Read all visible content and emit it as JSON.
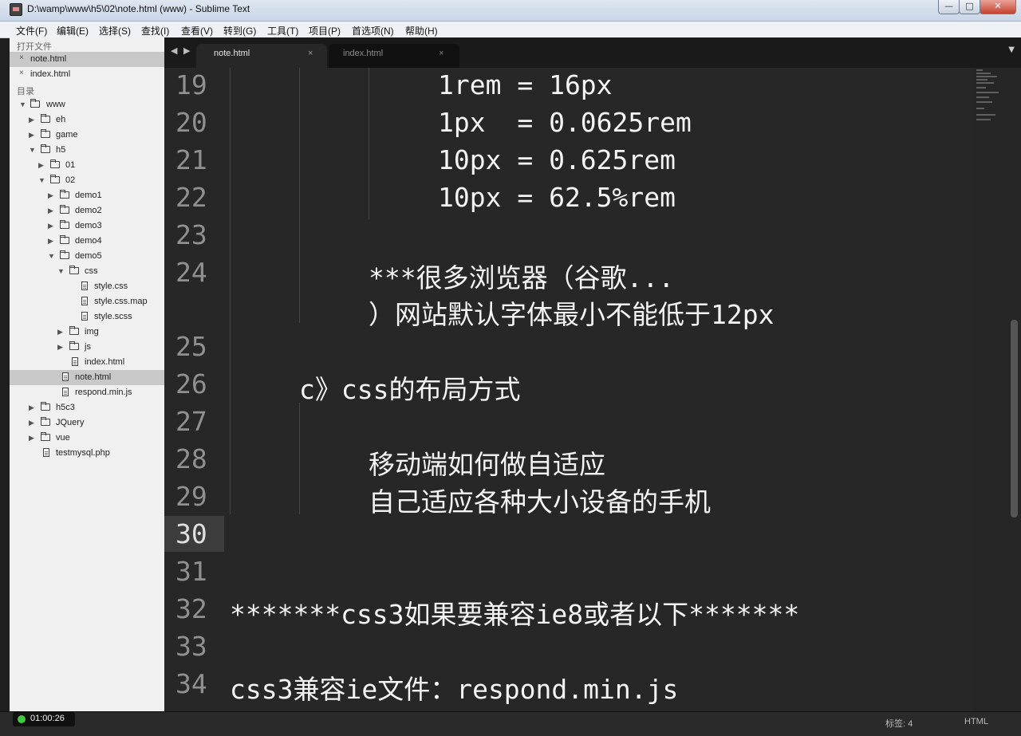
{
  "window": {
    "title": "D:\\wamp\\www\\h5\\02\\note.html (www) - Sublime Text",
    "minimize": "—",
    "maximize": "□",
    "close": "✕"
  },
  "menu": [
    "文件(F)",
    "编辑(E)",
    "选择(S)",
    "查找(I)",
    "查看(V)",
    "转到(G)",
    "工具(T)",
    "项目(P)",
    "首选项(N)",
    "帮助(H)"
  ],
  "sidebar": {
    "open_files_header": "打开文件",
    "open_files": [
      {
        "name": "note.html",
        "close": "×"
      },
      {
        "name": "index.html",
        "close": "×"
      }
    ],
    "folders_header": "目录",
    "tree": [
      {
        "name": "www",
        "type": "folder",
        "expanded": true
      },
      {
        "name": "eh",
        "type": "folder"
      },
      {
        "name": "game",
        "type": "folder"
      },
      {
        "name": "h5",
        "type": "folder",
        "expanded": true
      },
      {
        "name": "01",
        "type": "folder"
      },
      {
        "name": "02",
        "type": "folder",
        "expanded": true
      },
      {
        "name": "demo1",
        "type": "folder"
      },
      {
        "name": "demo2",
        "type": "folder"
      },
      {
        "name": "demo3",
        "type": "folder"
      },
      {
        "name": "demo4",
        "type": "folder"
      },
      {
        "name": "demo5",
        "type": "folder",
        "expanded": true
      },
      {
        "name": "css",
        "type": "folder",
        "expanded": true
      },
      {
        "name": "style.css",
        "type": "file"
      },
      {
        "name": "style.css.map",
        "type": "file"
      },
      {
        "name": "style.scss",
        "type": "file"
      },
      {
        "name": "img",
        "type": "folder"
      },
      {
        "name": "js",
        "type": "folder"
      },
      {
        "name": "index.html",
        "type": "file"
      },
      {
        "name": "note.html",
        "type": "file",
        "selected": true
      },
      {
        "name": "respond.min.js",
        "type": "file"
      },
      {
        "name": "h5c3",
        "type": "folder"
      },
      {
        "name": "JQuery",
        "type": "folder"
      },
      {
        "name": "vue",
        "type": "folder"
      },
      {
        "name": "testmysql.php",
        "type": "file"
      }
    ]
  },
  "tabs": {
    "nav": "◀ ▶",
    "active": {
      "label": "note.html",
      "close": "×"
    },
    "inactive": {
      "label": "index.html",
      "close": "×"
    },
    "dropdown": "▼"
  },
  "editor": {
    "current_line": "30",
    "lines": [
      {
        "no": "19",
        "text": "1rem = 16px"
      },
      {
        "no": "20",
        "text": "1px  = 0.0625rem"
      },
      {
        "no": "21",
        "text": "10px = 0.625rem"
      },
      {
        "no": "22",
        "text": "10px = 62.5%rem"
      },
      {
        "no": "23",
        "text": ""
      },
      {
        "no": "24",
        "text": "***很多浏览器（谷歌..."
      },
      {
        "no": "",
        "text": "）网站默认字体最小不能低于12px"
      },
      {
        "no": "25",
        "text": ""
      },
      {
        "no": "26",
        "text": "c》css的布局方式"
      },
      {
        "no": "27",
        "text": ""
      },
      {
        "no": "28",
        "text": "移动端如何做自适应"
      },
      {
        "no": "29",
        "text": "自己适应各种大小设备的手机"
      },
      {
        "no": "30",
        "text": ""
      },
      {
        "no": "31",
        "text": ""
      },
      {
        "no": "32",
        "text": "*******css3如果要兼容ie8或者以下*******"
      },
      {
        "no": "33",
        "text": ""
      },
      {
        "no": "34",
        "text": "css3兼容ie文件：respond.min.js"
      }
    ]
  },
  "status": {
    "timer": "01:00:26",
    "tab_size": "标签: 4",
    "syntax": "HTML"
  }
}
